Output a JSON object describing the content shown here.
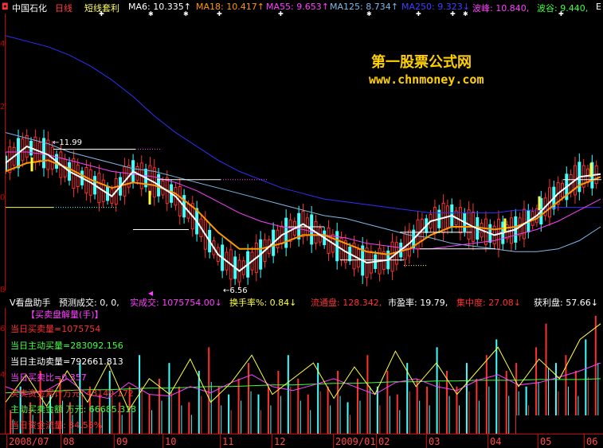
{
  "header": {
    "stock_icon": "stock-marker-icon",
    "stock_name": "中国石化",
    "period": "日线",
    "formula": "短线套利",
    "ma6": "MA6: 10.335↑",
    "ma18": "MA18: 10.417↑",
    "ma55": "MA55: 9.653↑",
    "ma125": "MA125: 8.734↑",
    "ma250": "MA250: 9.323↓",
    "wave_peak": "波峰: 10.840,",
    "wave_valley": "波谷: 9.440,",
    "more": "E"
  },
  "price_axis": {
    "labels": [
      "4",
      "2",
      "0",
      "8"
    ]
  },
  "annotations": {
    "high_price": "11.99",
    "low_price": "6.56"
  },
  "watermark": {
    "title": "第一股票公式网",
    "url": "www.chnmoney.com"
  },
  "vol_header": {
    "indicator": "V看盘助手",
    "forecast": "预测成交: 0, 0,",
    "actual": "实成交: 1075754.00↓",
    "turnover": "换手率%: 0.84↓",
    "float_cap": "流通盘: 128.342,",
    "pe": "市盈率: 19.79,",
    "concentration": "集中度: 27.08↓",
    "profit": "获利盘: 57.66↓"
  },
  "vol_panel": {
    "title": "【买卖盘解量(手)】",
    "stats": [
      "当日买卖量=1075754",
      "当日主动买量=283092.156",
      "当日主动卖量=792661.813",
      "当日买卖比=0.357",
      "买卖资金累计万元: 43149.172",
      "主动买卖金额 万元: 66685.313",
      "当日资金流量: 84.58%"
    ],
    "axis_labels": [
      "6",
      "4"
    ]
  },
  "date_axis": {
    "labels": [
      "2008/07",
      "08",
      "09",
      "10",
      "11",
      "12",
      "2009/01",
      "02",
      "03",
      "04",
      "05",
      "06"
    ]
  },
  "colors": {
    "ma_white": "#ffffff",
    "ma_orange": "#ff9900",
    "ma_magenta": "#ff40ff",
    "ma_lightblue": "#7fb8e8",
    "ma_blue": "#3030ff",
    "up_candle": "#ff3030",
    "down_candle": "#40ffff",
    "line_yellow": "#ffff40"
  },
  "chart_data": {
    "type": "line",
    "series": [
      {
        "name": "MA6",
        "values": [
          10.9,
          11.5,
          11.2,
          10.6,
          10.2,
          9.7,
          10.6,
          10.2,
          9.7,
          8.8,
          7.6,
          7.0,
          7.6,
          8.3,
          8.7,
          8.2,
          7.7,
          7.3,
          7.4,
          8.0,
          8.8,
          9.0,
          8.6,
          8.3,
          8.5,
          9.0,
          9.8,
          10.4,
          10.5
        ]
      },
      {
        "name": "MA18",
        "values": [
          10.6,
          10.9,
          11.0,
          10.7,
          10.3,
          10.0,
          10.2,
          10.1,
          9.8,
          9.2,
          8.4,
          7.8,
          7.8,
          8.0,
          8.3,
          8.3,
          8.0,
          7.7,
          7.6,
          7.8,
          8.3,
          8.6,
          8.6,
          8.5,
          8.6,
          8.9,
          9.5,
          10.1,
          10.4
        ]
      },
      {
        "name": "MA55",
        "values": [
          11.3,
          11.3,
          11.2,
          11.0,
          10.8,
          10.6,
          10.5,
          10.4,
          10.2,
          9.9,
          9.5,
          9.1,
          8.8,
          8.6,
          8.5,
          8.3,
          8.2,
          8.0,
          7.9,
          7.8,
          7.8,
          7.9,
          8.0,
          8.1,
          8.3,
          8.5,
          8.8,
          9.2,
          9.6
        ]
      },
      {
        "name": "MA125",
        "values": [
          12.0,
          11.8,
          11.6,
          11.3,
          11.1,
          10.9,
          10.7,
          10.6,
          10.4,
          10.2,
          10.0,
          9.8,
          9.6,
          9.4,
          9.2,
          9.0,
          8.9,
          8.7,
          8.5,
          8.3,
          8.2,
          8.0,
          7.9,
          7.8,
          7.7,
          7.7,
          7.8,
          8.1,
          8.6
        ]
      },
      {
        "name": "MA250",
        "values": [
          15.5,
          15.3,
          15.1,
          14.8,
          14.4,
          13.9,
          13.3,
          12.6,
          12.0,
          11.5,
          11.0,
          10.6,
          10.3,
          10.0,
          9.8,
          9.6,
          9.5,
          9.4,
          9.3,
          9.2,
          9.1,
          9.1,
          9.1,
          9.1,
          9.2,
          9.2,
          9.3,
          9.3,
          9.3
        ]
      }
    ],
    "ylim": [
      6.3,
      16.3
    ],
    "volume": [
      3,
      6,
      4,
      8,
      5,
      7,
      4,
      9,
      6,
      5,
      8,
      4,
      6,
      10,
      5,
      7,
      9,
      6,
      4,
      8,
      11,
      6,
      5,
      7,
      9,
      5,
      6,
      8,
      10,
      7,
      5,
      9,
      6,
      8,
      4,
      7,
      10,
      6,
      8,
      5,
      9,
      7,
      6,
      11,
      8,
      6,
      9,
      7,
      10,
      12,
      8,
      9,
      6,
      11,
      14,
      9,
      10,
      8,
      12,
      15
    ],
    "vol_line_green": [
      5.2,
      5.3,
      5.4,
      5.5,
      5.6,
      5.6,
      5.7,
      5.8,
      5.8,
      5.9,
      6.0,
      6.0,
      6.1,
      6.2,
      6.2,
      6.3,
      6.4,
      6.4,
      6.5,
      6.6,
      6.6,
      6.7,
      6.7,
      6.8,
      6.8,
      6.8,
      6.9,
      6.9,
      6.9,
      7.0
    ],
    "vol_line_magenta": [
      6.0,
      5.0,
      5.5,
      7.0,
      5.0,
      4.5,
      6.5,
      5.0,
      4.8,
      6.0,
      5.2,
      6.5,
      7.5,
      6.0,
      5.5,
      6.2,
      7.0,
      6.0,
      5.0,
      6.5,
      7.0,
      6.0,
      5.5,
      6.8,
      7.5,
      6.2,
      6.5,
      7.2,
      8.0,
      9.0
    ],
    "vol_line_yellow": [
      4.0,
      7.5,
      3.5,
      8.0,
      4.0,
      9.0,
      3.0,
      7.0,
      5.0,
      9.5,
      4.0,
      6.5,
      10.0,
      5.0,
      7.0,
      9.0,
      4.5,
      8.5,
      5.0,
      10.5,
      6.0,
      9.0,
      5.0,
      8.0,
      11.0,
      6.0,
      9.5,
      7.0,
      12.0,
      14.0
    ],
    "vol_ylim": [
      0,
      16
    ]
  }
}
